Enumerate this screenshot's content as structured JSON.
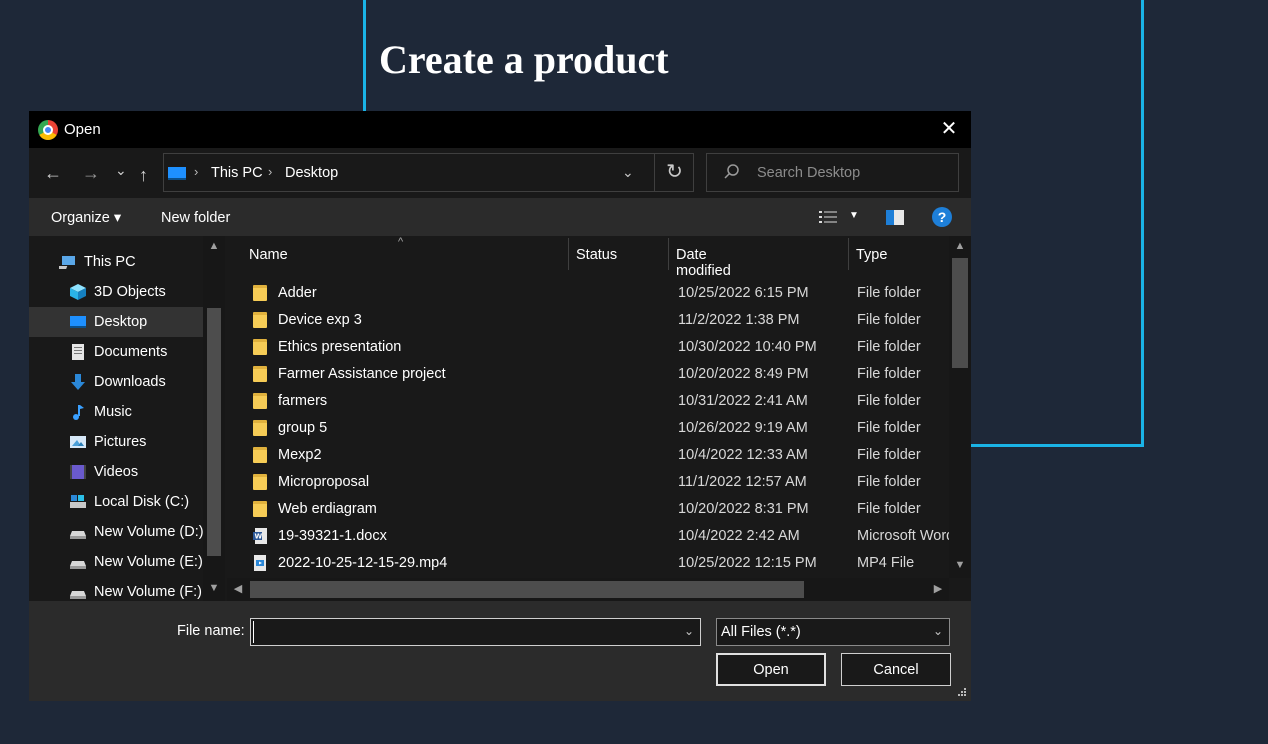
{
  "page": {
    "title": "Create a product"
  },
  "dialog": {
    "title": "Open",
    "close_glyph": "✕",
    "nav": {
      "back": "←",
      "forward": "→",
      "recent": "⌄",
      "up": "↑"
    },
    "breadcrumb": [
      "This PC",
      "Desktop"
    ],
    "breadcrumb_sep": "›",
    "address_drop": "⌄",
    "refresh": "↻",
    "search_placeholder": "Search Desktop",
    "toolbar": {
      "organize": "Organize ▾",
      "new_folder": "New folder",
      "view_drop": "▼",
      "help": "?"
    },
    "sidebar": [
      {
        "label": "This PC",
        "icon": "computer-icon"
      },
      {
        "label": "3D Objects",
        "icon": "cube-icon"
      },
      {
        "label": "Desktop",
        "icon": "desktop-icon",
        "active": true
      },
      {
        "label": "Documents",
        "icon": "documents-icon"
      },
      {
        "label": "Downloads",
        "icon": "download-icon"
      },
      {
        "label": "Music",
        "icon": "music-icon"
      },
      {
        "label": "Pictures",
        "icon": "pictures-icon"
      },
      {
        "label": "Videos",
        "icon": "videos-icon"
      },
      {
        "label": "Local Disk (C:)",
        "icon": "disk-icon"
      },
      {
        "label": "New Volume (D:)",
        "icon": "drive-icon"
      },
      {
        "label": "New Volume (E:)",
        "icon": "drive-icon"
      },
      {
        "label": "New Volume (F:)",
        "icon": "drive-icon"
      }
    ],
    "columns": {
      "name": "Name",
      "status": "Status",
      "date": "Date modified",
      "type": "Type"
    },
    "files": [
      {
        "name": "Adder",
        "date": "10/25/2022 6:15 PM",
        "type": "File folder",
        "kind": "folder"
      },
      {
        "name": "Device exp 3",
        "date": "11/2/2022 1:38 PM",
        "type": "File folder",
        "kind": "folder"
      },
      {
        "name": "Ethics presentation",
        "date": "10/30/2022 10:40 PM",
        "type": "File folder",
        "kind": "folder"
      },
      {
        "name": "Farmer Assistance project",
        "date": "10/20/2022 8:49 PM",
        "type": "File folder",
        "kind": "folder"
      },
      {
        "name": "farmers",
        "date": "10/31/2022 2:41 AM",
        "type": "File folder",
        "kind": "folder"
      },
      {
        "name": "group 5",
        "date": "10/26/2022 9:19 AM",
        "type": "File folder",
        "kind": "folder"
      },
      {
        "name": "Mexp2",
        "date": "10/4/2022 12:33 AM",
        "type": "File folder",
        "kind": "folder"
      },
      {
        "name": "Microproposal",
        "date": "11/1/2022 12:57 AM",
        "type": "File folder",
        "kind": "folder"
      },
      {
        "name": "Web erdiagram",
        "date": "10/20/2022 8:31 PM",
        "type": "File folder",
        "kind": "folder"
      },
      {
        "name": "19-39321-1.docx",
        "date": "10/4/2022 2:42 AM",
        "type": "Microsoft Word",
        "kind": "word"
      },
      {
        "name": "2022-10-25-12-15-29.mp4",
        "date": "10/25/2022 12:15 PM",
        "type": "MP4 File",
        "kind": "video"
      }
    ],
    "footer": {
      "file_name_label": "File name:",
      "file_name_value": "",
      "file_type": "All Files (*.*)",
      "drop_glyph": "⌄",
      "open": "Open",
      "cancel": "Cancel"
    },
    "colors": {
      "accent": "#1ab3e6",
      "page_bg": "#1e2838",
      "folder": "#f6cc56"
    }
  }
}
